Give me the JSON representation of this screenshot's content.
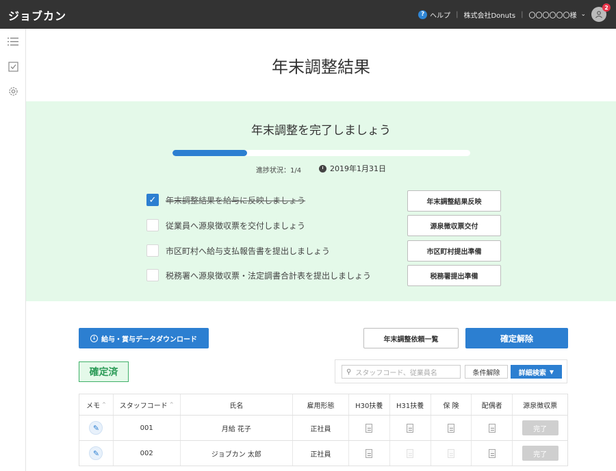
{
  "header": {
    "logo": "ジョブカン",
    "help_label": "ヘルプ",
    "company": "株式会社Donuts",
    "user": "〇〇〇〇〇〇様",
    "notification_count": "2"
  },
  "page": {
    "title": "年末調整結果"
  },
  "progress": {
    "heading": "年末調整を完了しましょう",
    "status_label": "進捗状況：1/4",
    "completed": 1,
    "total": 4,
    "deadline": "2019年1月31日",
    "tasks": [
      {
        "label": "年末調整結果を給与に反映しましょう",
        "done": true,
        "button": "年末調整結果反映"
      },
      {
        "label": "従業員へ源泉徴収票を交付しましょう",
        "done": false,
        "button": "源泉徴収票交付"
      },
      {
        "label": "市区町村へ給与支払報告書を提出しましょう",
        "done": false,
        "button": "市区町村提出準備"
      },
      {
        "label": "税務署へ源泉徴収票・法定調書合計表を提出しましょう",
        "done": false,
        "button": "税務署提出準備"
      }
    ]
  },
  "actions": {
    "download": "給与・賞与データダウンロード",
    "request_list": "年末調整依頼一覧",
    "unconfirm": "確定解除"
  },
  "status_tag": "確定済",
  "filter": {
    "search_placeholder": "スタッフコード、従業員名",
    "clear": "条件解除",
    "advanced": "詳細検索"
  },
  "table": {
    "headers": {
      "memo": "メモ",
      "code": "スタッフコード",
      "name": "氏名",
      "employment": "雇用形態",
      "h30": "H30扶養",
      "h31": "H31扶養",
      "insurance": "保 険",
      "spouse": "配偶者",
      "withholding": "源泉徴収票"
    },
    "rows": [
      {
        "code": "001",
        "name": "月給 花子",
        "employment": "正社員",
        "h30": true,
        "h31": true,
        "insurance": true,
        "spouse": true,
        "status": "完了"
      },
      {
        "code": "002",
        "name": "ジョブカン 太郎",
        "employment": "正社員",
        "h30": true,
        "h31": false,
        "insurance": false,
        "spouse": true,
        "status": "完了"
      }
    ]
  }
}
